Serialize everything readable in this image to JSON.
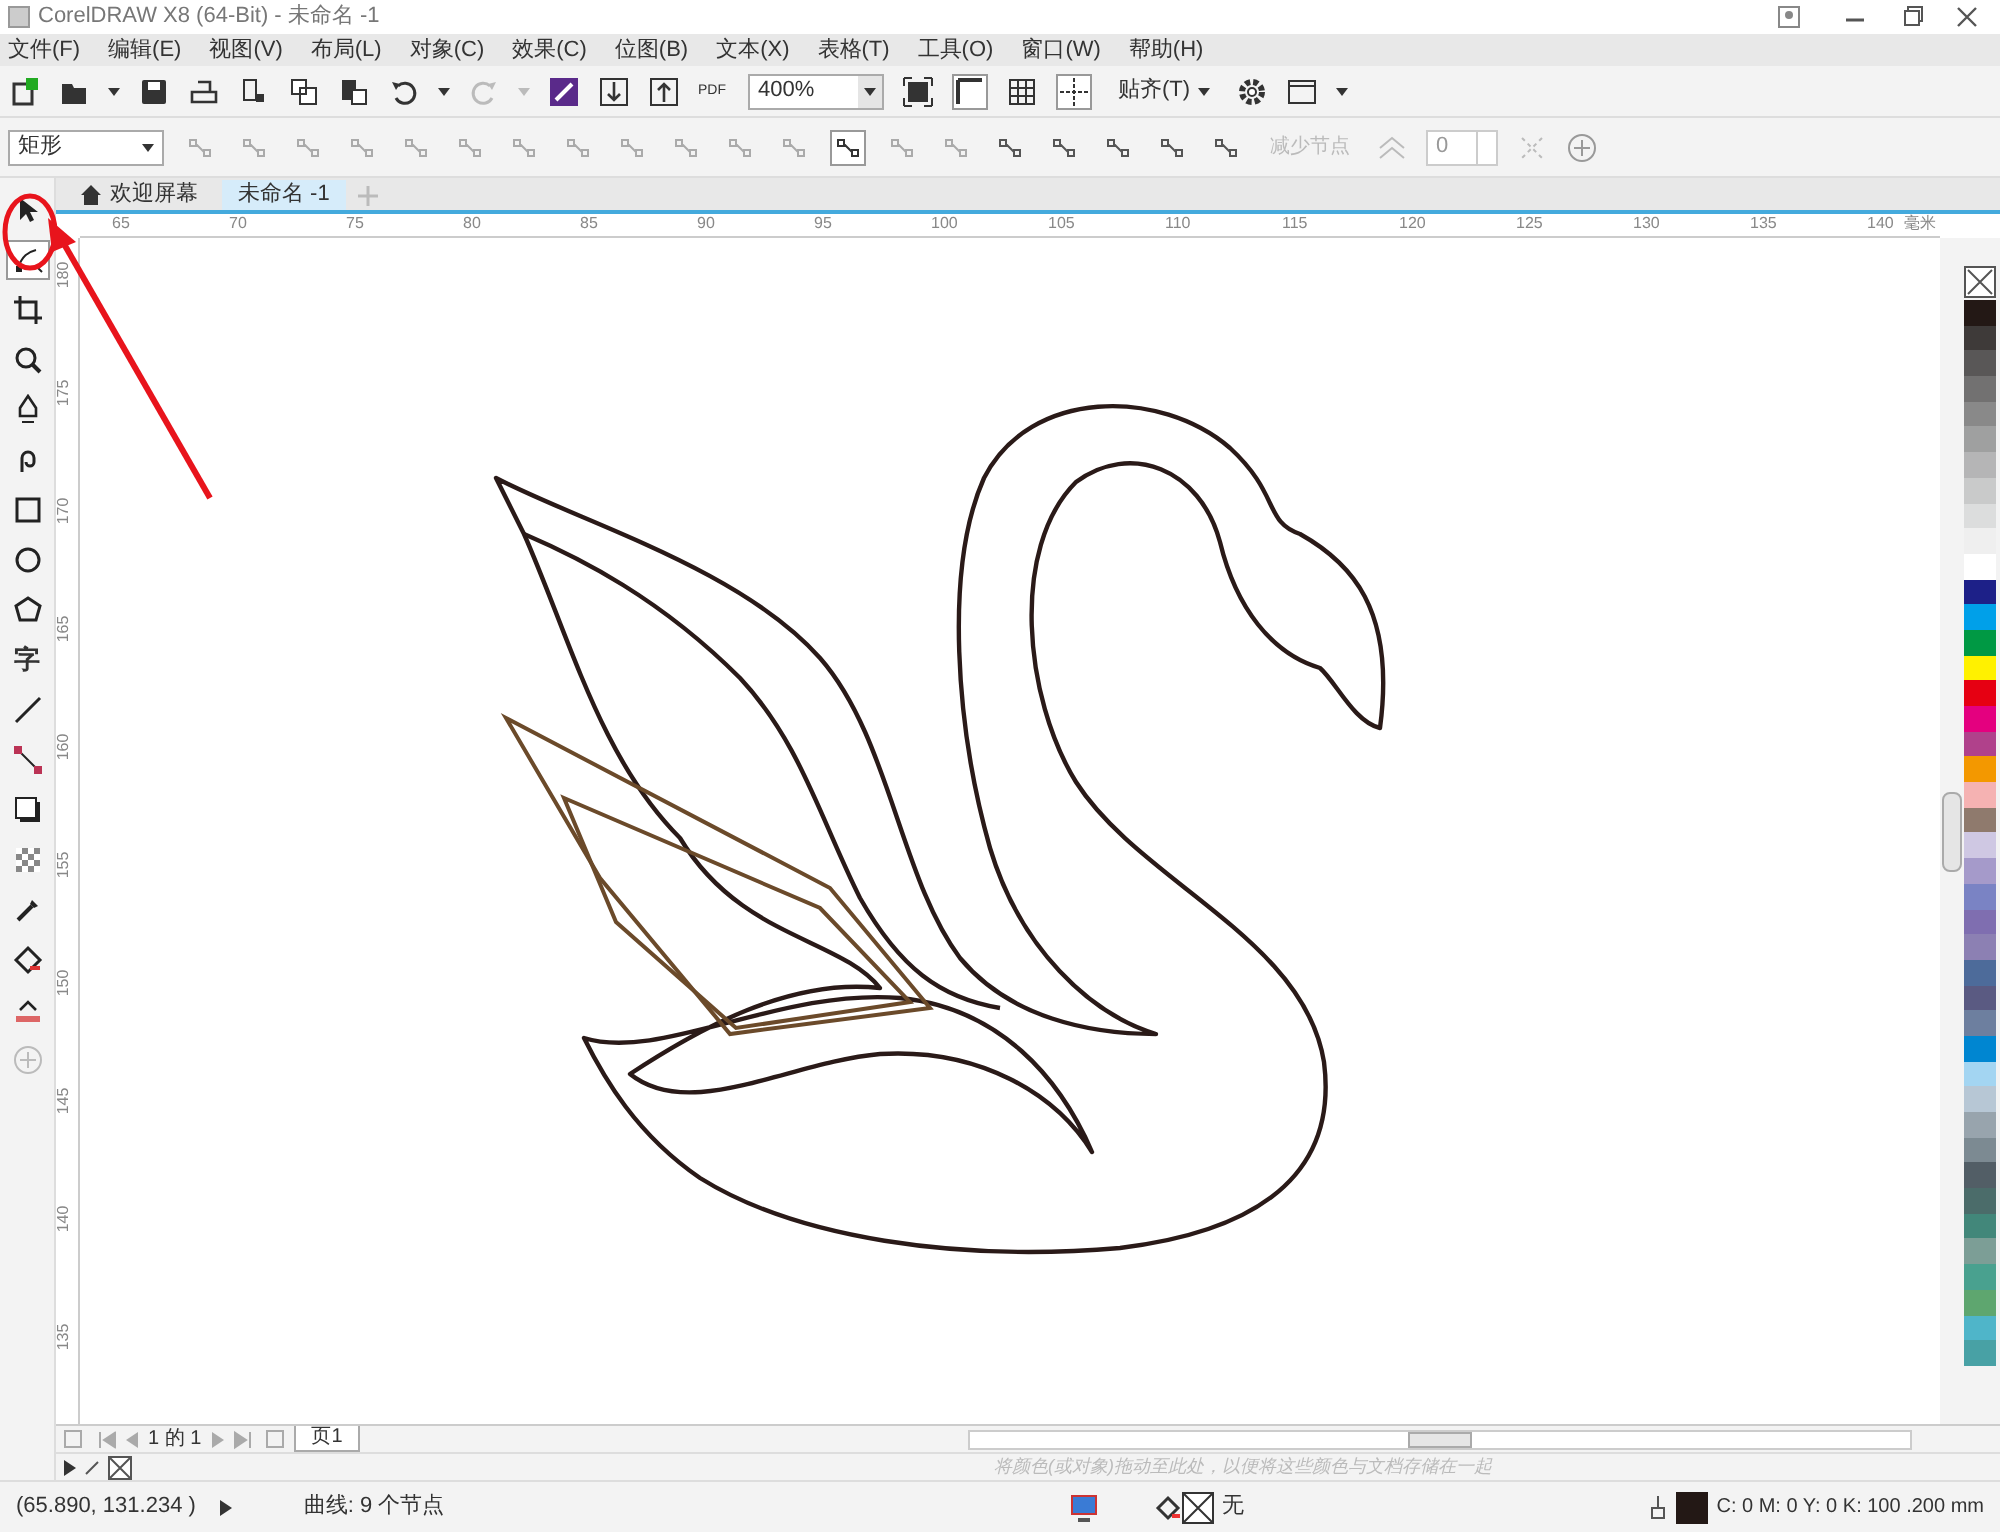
{
  "window": {
    "title": "CorelDRAW X8 (64-Bit) - 未命名 -1"
  },
  "menu": [
    "文件(F)",
    "编辑(E)",
    "视图(V)",
    "布局(L)",
    "对象(C)",
    "效果(C)",
    "位图(B)",
    "文本(X)",
    "表格(T)",
    "工具(O)",
    "窗口(W)",
    "帮助(H)"
  ],
  "toolbar": {
    "pdf_label": "PDF",
    "zoom": "400%",
    "snap": "贴齐(T)"
  },
  "property_bar": {
    "shape_type": "矩形",
    "reduce_nodes": "减少节点",
    "smoothness": "0"
  },
  "doc_tabs": [
    {
      "label": "欢迎屏幕",
      "selected": false
    },
    {
      "label": "未命名 -1",
      "selected": true
    }
  ],
  "ruler": {
    "h_ticks": [
      "65",
      "70",
      "75",
      "80",
      "85",
      "90",
      "95",
      "100",
      "105",
      "110",
      "115",
      "120",
      "125",
      "130",
      "135",
      "140"
    ],
    "unit": "毫米",
    "v_ticks": [
      "180",
      "175",
      "170",
      "165",
      "160",
      "155",
      "150",
      "145",
      "140",
      "135"
    ]
  },
  "tools": [
    {
      "kind": "pick",
      "selected": false
    },
    {
      "kind": "shape",
      "selected": true
    },
    {
      "kind": "crop",
      "selected": false
    },
    {
      "kind": "zoom",
      "selected": false
    },
    {
      "kind": "pen",
      "selected": false
    },
    {
      "kind": "curve",
      "selected": false
    },
    {
      "kind": "rect",
      "selected": false
    },
    {
      "kind": "ellipse",
      "selected": false
    },
    {
      "kind": "polygon",
      "selected": false
    },
    {
      "kind": "text",
      "label": "字",
      "selected": false
    },
    {
      "kind": "line",
      "selected": false
    },
    {
      "kind": "connector",
      "selected": false
    },
    {
      "kind": "shadow",
      "selected": false
    },
    {
      "kind": "transparency",
      "selected": false
    },
    {
      "kind": "eyedropper",
      "selected": false
    },
    {
      "kind": "fill",
      "selected": false
    },
    {
      "kind": "smartfill",
      "selected": false
    },
    {
      "kind": "add",
      "selected": false
    }
  ],
  "palette": [
    {
      "kind": "none"
    },
    {
      "color": "#231815"
    },
    {
      "color": "#3e3a39"
    },
    {
      "color": "#595757"
    },
    {
      "color": "#727171"
    },
    {
      "color": "#898989"
    },
    {
      "color": "#9fa0a0"
    },
    {
      "color": "#b5b5b6"
    },
    {
      "color": "#c9caca"
    },
    {
      "color": "#dcdddd"
    },
    {
      "color": "#efefef"
    },
    {
      "color": "#ffffff"
    },
    {
      "color": "#1d2088"
    },
    {
      "color": "#00a0e9"
    },
    {
      "color": "#009944"
    },
    {
      "color": "#fff100"
    },
    {
      "color": "#e60012"
    },
    {
      "color": "#e4007f"
    },
    {
      "color": "#b0418b"
    },
    {
      "color": "#f39800"
    },
    {
      "color": "#f5b2b2"
    },
    {
      "color": "#8f7a6d"
    },
    {
      "color": "#cfc8e3"
    },
    {
      "color": "#a59aca"
    },
    {
      "color": "#7a83c4"
    },
    {
      "color": "#7f6eb0"
    },
    {
      "color": "#8c80b3"
    },
    {
      "color": "#4d6b9a"
    },
    {
      "color": "#5a5a82"
    },
    {
      "color": "#6d7f9f"
    },
    {
      "color": "#0086d1"
    },
    {
      "color": "#a3d5f2"
    },
    {
      "color": "#b7c7d5"
    },
    {
      "color": "#98a4ad"
    },
    {
      "color": "#7c8a92"
    },
    {
      "color": "#525e66"
    },
    {
      "color": "#4b6c6a"
    },
    {
      "color": "#42877a"
    },
    {
      "color": "#7c9e96"
    },
    {
      "color": "#49a18f"
    },
    {
      "color": "#5ea66f"
    },
    {
      "color": "#4fb5c9"
    },
    {
      "color": "#48a1a5"
    }
  ],
  "page_nav": {
    "page_count": "1 的 1",
    "page_tab": "页1"
  },
  "doc_palette_hint": "将颜色(或对象)拖动至此处，以便将这些颜色与文档存储在一起",
  "status": {
    "coords": "(65.890, 131.234 )",
    "object_info": "曲线: 9 个节点",
    "fill": "无",
    "outline": "C: 0 M: 0 Y: 0 K: 100 .200 mm"
  }
}
